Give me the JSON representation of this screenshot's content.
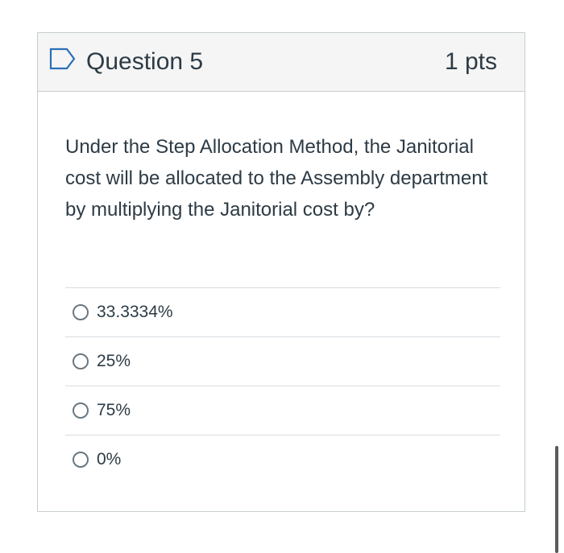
{
  "question": {
    "title": "Question 5",
    "points": "1 pts",
    "flag_icon": "flag-outline-icon",
    "text": "Under the Step Allocation Method, the Janitorial cost will be allocated to the Assembly department by multiplying the Janitorial cost by?"
  },
  "answers": [
    {
      "label": "33.3334%",
      "selected": false
    },
    {
      "label": "25%",
      "selected": false
    },
    {
      "label": "75%",
      "selected": false
    },
    {
      "label": "0%",
      "selected": false
    }
  ],
  "colors": {
    "text": "#2d3b45",
    "header_bg": "#f5f5f5",
    "border": "#c7cdd1",
    "flag": "#2d6fb7"
  }
}
